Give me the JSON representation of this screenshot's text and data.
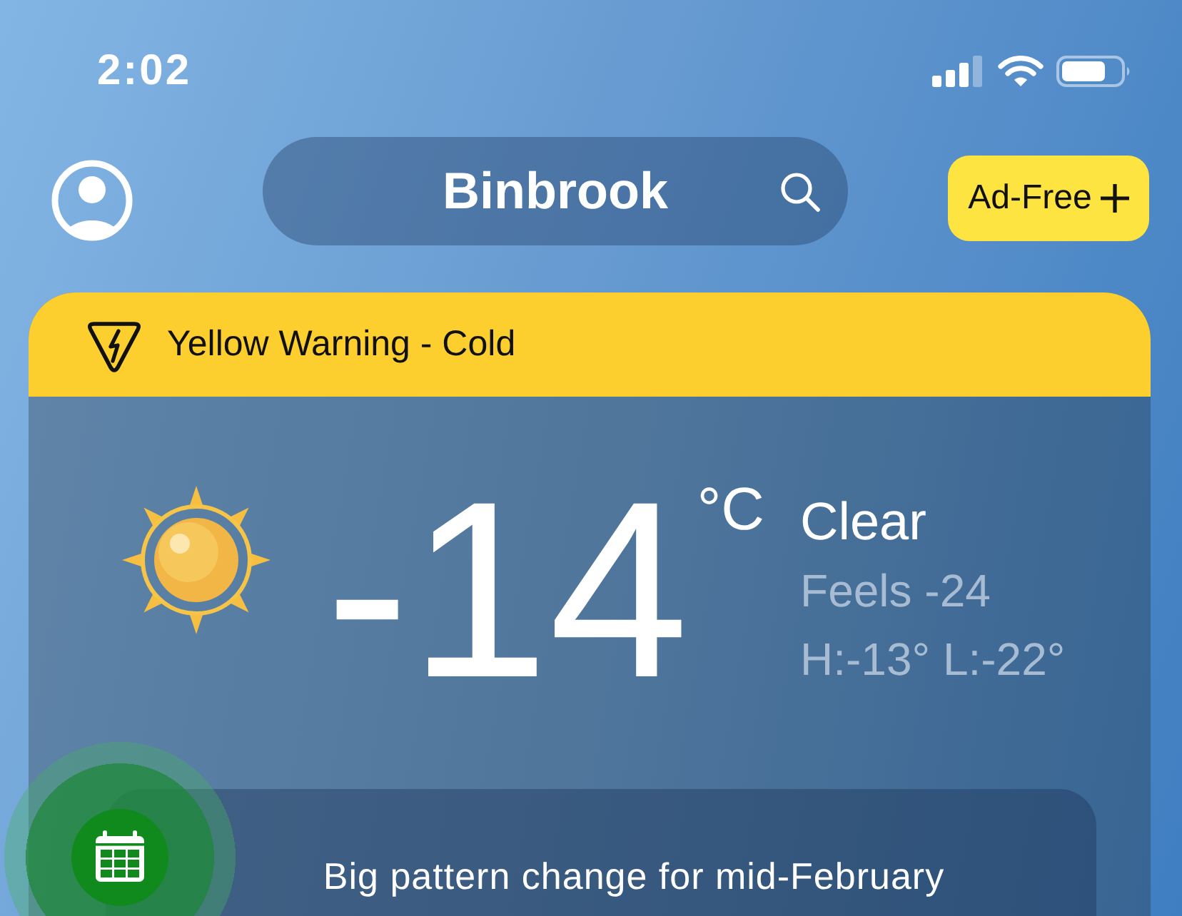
{
  "status_bar": {
    "time": "2:02"
  },
  "header": {
    "location": "Binbrook",
    "upgrade_button": "Ad-Free"
  },
  "warning": {
    "text": "Yellow Warning - Cold"
  },
  "current": {
    "temperature": "-14",
    "unit": "°C",
    "condition": "Clear",
    "feels_like": "Feels -24",
    "high_low": "H:-13° L:-22°"
  },
  "news": {
    "headline": "Big pattern change for mid-February"
  }
}
